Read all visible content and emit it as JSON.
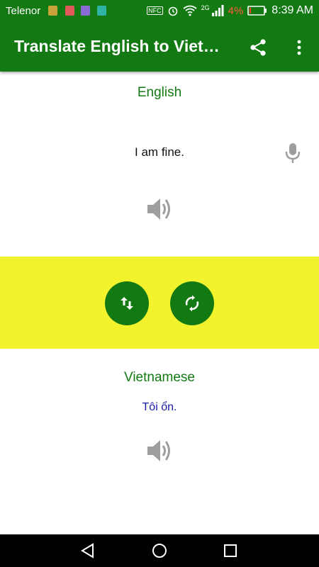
{
  "status_bar": {
    "carrier": "Telenor",
    "network": "2G",
    "battery_percent": "4%",
    "time": "8:39 AM",
    "nfc_label": "NFC"
  },
  "app_bar": {
    "title": "Translate English to Vietnamese",
    "share_icon": "share-icon",
    "overflow_icon": "more-vert-icon"
  },
  "source": {
    "language": "English",
    "text": "I am fine.",
    "mic_icon": "mic-icon",
    "speaker_icon": "speaker-icon"
  },
  "actions": {
    "swap_icon": "swap-vertical-icon",
    "translate_icon": "refresh-icon",
    "band_color": "#f3f32d",
    "accent_color": "#137913"
  },
  "target": {
    "language": "Vietnamese",
    "text": "Tôi ổn.",
    "speaker_icon": "speaker-icon"
  },
  "nav_bar": {
    "back_icon": "back-triangle-icon",
    "home_icon": "home-circle-icon",
    "recent_icon": "recent-square-icon"
  }
}
